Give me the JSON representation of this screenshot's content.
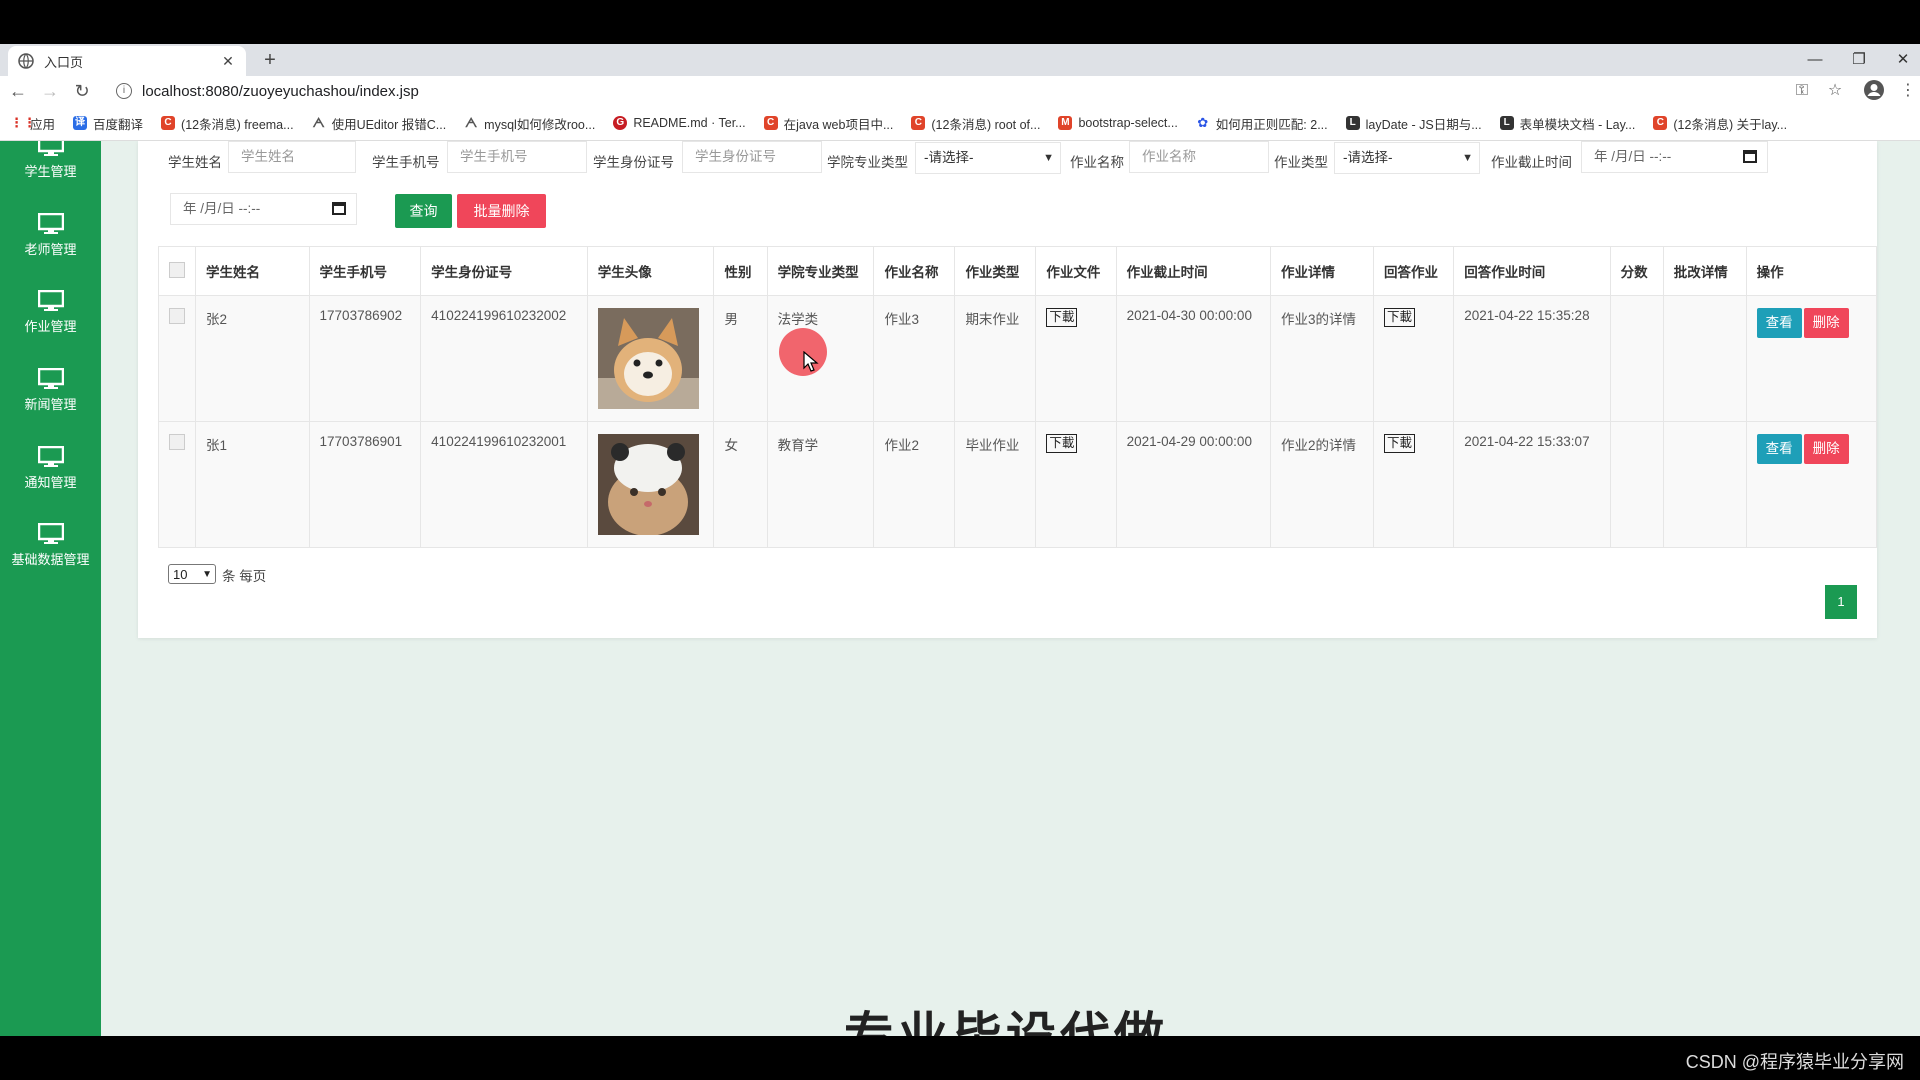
{
  "browser": {
    "tab_title": "入口页",
    "tab_close": "✕",
    "new_tab": "+",
    "url": "localhost:8080/zuoyeyuchashou/index.jsp",
    "window_controls": {
      "minimize": "—",
      "restore": "❐",
      "close": "✕"
    }
  },
  "bookmarks": [
    {
      "label": "应用",
      "icon": "apps-grid-icon",
      "color": "#d93025"
    },
    {
      "label": "百度翻译",
      "icon": "baidu-translate-icon",
      "color": "#2b6de6"
    },
    {
      "label": "(12条消息) freema...",
      "icon": "csdn-icon",
      "color": "#e0442a"
    },
    {
      "label": "使用UEditor 报错C...",
      "icon": "link-icon",
      "color": "#555555"
    },
    {
      "label": "mysql如何修改roo...",
      "icon": "link-icon",
      "color": "#555555"
    },
    {
      "label": "README.md · Ter...",
      "icon": "gitee-icon",
      "color": "#c71d23"
    },
    {
      "label": "在java web项目中...",
      "icon": "csdn-icon",
      "color": "#e0442a"
    },
    {
      "label": "(12条消息) root of...",
      "icon": "csdn-icon",
      "color": "#e0442a"
    },
    {
      "label": "bootstrap-select...",
      "icon": "m-icon",
      "color": "#e0442a"
    },
    {
      "label": "如何用正则匹配: 2...",
      "icon": "baidu-paw-icon",
      "color": "#2b55e6"
    },
    {
      "label": "layDate - JS日期与...",
      "icon": "layui-icon",
      "color": "#333333"
    },
    {
      "label": "表单模块文档 - Lay...",
      "icon": "layui-icon",
      "color": "#333333"
    },
    {
      "label": "(12条消息) 关于lay...",
      "icon": "csdn-icon",
      "color": "#e0442a"
    }
  ],
  "sidebar": {
    "items": [
      {
        "label": "学生管理"
      },
      {
        "label": "老师管理"
      },
      {
        "label": "作业管理"
      },
      {
        "label": "新闻管理"
      },
      {
        "label": "通知管理"
      },
      {
        "label": "基础数据管理"
      }
    ]
  },
  "filters": {
    "student_name": {
      "label": "学生姓名",
      "placeholder": "学生姓名"
    },
    "student_phone": {
      "label": "学生手机号",
      "placeholder": "学生手机号"
    },
    "student_id_card": {
      "label": "学生身份证号",
      "placeholder": "学生身份证号"
    },
    "major_type": {
      "label": "学院专业类型",
      "value": "-请选择-"
    },
    "homework_name": {
      "label": "作业名称",
      "placeholder": "作业名称"
    },
    "homework_type": {
      "label": "作业类型",
      "value": "-请选择-"
    },
    "deadline": {
      "label": "作业截止时间",
      "value": "年 /月/日 --:--"
    },
    "deadline_end": {
      "value": "年 /月/日 --:--"
    },
    "query_button": "查询",
    "batch_delete_button": "批量删除"
  },
  "table": {
    "headers": [
      "学生姓名",
      "学生手机号",
      "学生身份证号",
      "学生头像",
      "性别",
      "学院专业类型",
      "作业名称",
      "作业类型",
      "作业文件",
      "作业截止时间",
      "作业详情",
      "回答作业",
      "回答作业时间",
      "分数",
      "批改详情",
      "操作"
    ],
    "rows": [
      {
        "name": "张2",
        "phone": "17703786902",
        "id_card": "410224199610232002",
        "avatar": "shiba-dog-photo",
        "gender": "男",
        "major": "法学类",
        "homework": "作业3",
        "hw_type": "期末作业",
        "hw_file": "下載",
        "deadline": "2021-04-30 00:00:00",
        "detail": "作业3的详情",
        "answer": "下載",
        "answer_time": "2021-04-22 15:35:28",
        "score": "",
        "review": "",
        "view": "查看",
        "delete": "删除"
      },
      {
        "name": "张1",
        "phone": "17703786901",
        "id_card": "410224199610232001",
        "avatar": "cat-photo",
        "gender": "女",
        "major": "教育学",
        "homework": "作业2",
        "hw_type": "毕业作业",
        "hw_file": "下載",
        "deadline": "2021-04-29 00:00:00",
        "detail": "作业2的详情",
        "answer": "下載",
        "answer_time": "2021-04-22 15:33:07",
        "score": "",
        "review": "",
        "view": "查看",
        "delete": "删除"
      }
    ]
  },
  "pagination": {
    "page_size": "10",
    "per_page_label": "条 每页",
    "current_page": "1"
  },
  "banner_text": "专业毕设代做",
  "watermark": "CSDN @程序猿毕业分享网",
  "colors": {
    "sidebar": "#1b9a52",
    "primary": "#1b9a52",
    "info": "#1e9fb8",
    "danger": "#f0465a",
    "page_bg": "#e7f1ec"
  }
}
